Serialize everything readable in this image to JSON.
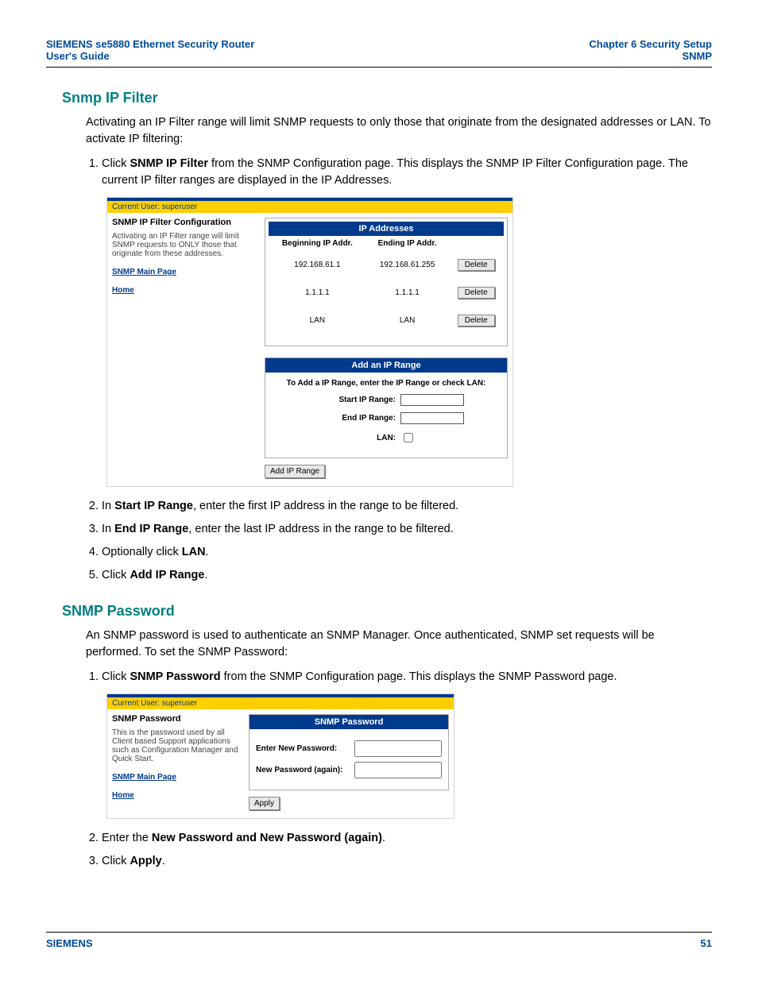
{
  "header": {
    "left_line1": "SIEMENS se5880 Ethernet Security Router",
    "left_line2": "User's Guide",
    "right_line1": "Chapter 6  Security Setup",
    "right_line2": "SNMP"
  },
  "section1": {
    "heading": "Snmp IP Filter",
    "intro": "Activating an IP Filter range will limit SNMP requests to only those that originate from the designated addresses or LAN. To activate IP filtering:",
    "step1_pre": "Click ",
    "step1_bold": "SNMP IP Filter",
    "step1_post": " from the SNMP Configuration page. This displays the SNMP IP Filter Configuration page. The current IP filter ranges are displayed in the IP Addresses.",
    "step2_pre": "In ",
    "step2_bold": "Start IP Range",
    "step2_post": ", enter the first IP address in the range to be filtered.",
    "step3_pre": "In ",
    "step3_bold": "End IP Range",
    "step3_post": ", enter the last IP address in the range to be filtered.",
    "step4_pre": "Optionally click ",
    "step4_bold": "LAN",
    "step4_post": ".",
    "step5_pre": "Click ",
    "step5_bold": "Add IP Range",
    "step5_post": "."
  },
  "ss1": {
    "current_user": "Current User: superuser",
    "title": "SNMP IP Filter Configuration",
    "desc": "Activating an IP Filter range will limit SNMP requests to ONLY those that originate from these addresses.",
    "link1": "SNMP Main Page",
    "link2": "Home",
    "ip_heading": "IP Addresses",
    "col1": "Beginning IP Addr.",
    "col2": "Ending IP Addr.",
    "rows": [
      {
        "begin": "192.168.61.1",
        "end": "192.168.61.255",
        "btn": "Delete"
      },
      {
        "begin": "1.1.1.1",
        "end": "1.1.1.1",
        "btn": "Delete"
      },
      {
        "begin": "LAN",
        "end": "LAN",
        "btn": "Delete"
      }
    ],
    "add_heading": "Add an IP Range",
    "add_desc": "To Add a IP Range, enter the IP Range or check LAN:",
    "start_label": "Start IP Range:",
    "end_label": "End IP Range:",
    "lan_label": "LAN:",
    "add_btn": "Add IP Range"
  },
  "section2": {
    "heading": "SNMP Password",
    "intro": "An SNMP password is used to authenticate an SNMP Manager. Once authenticated, SNMP set requests will be performed. To set the SNMP Password:",
    "step1_pre": "Click ",
    "step1_bold": "SNMP Password",
    "step1_post": " from the SNMP Configuration page. This displays the SNMP Password page.",
    "step2_pre": "Enter the ",
    "step2_bold": "New Password and New Password (again)",
    "step2_post": ".",
    "step3_pre": "Click ",
    "step3_bold": "Apply",
    "step3_post": "."
  },
  "ss2": {
    "current_user": "Current User: superuser",
    "title": "SNMP Password",
    "desc": "This is the password used by all Client based Support applications such as Configuration Manager and Quick Start.",
    "link1": "SNMP Main Page",
    "link2": "Home",
    "heading": "SNMP Password",
    "new_label": "Enter New Password:",
    "again_label": "New Password (again):",
    "apply_btn": "Apply"
  },
  "footer": {
    "brand": "SIEMENS",
    "page": "51"
  }
}
